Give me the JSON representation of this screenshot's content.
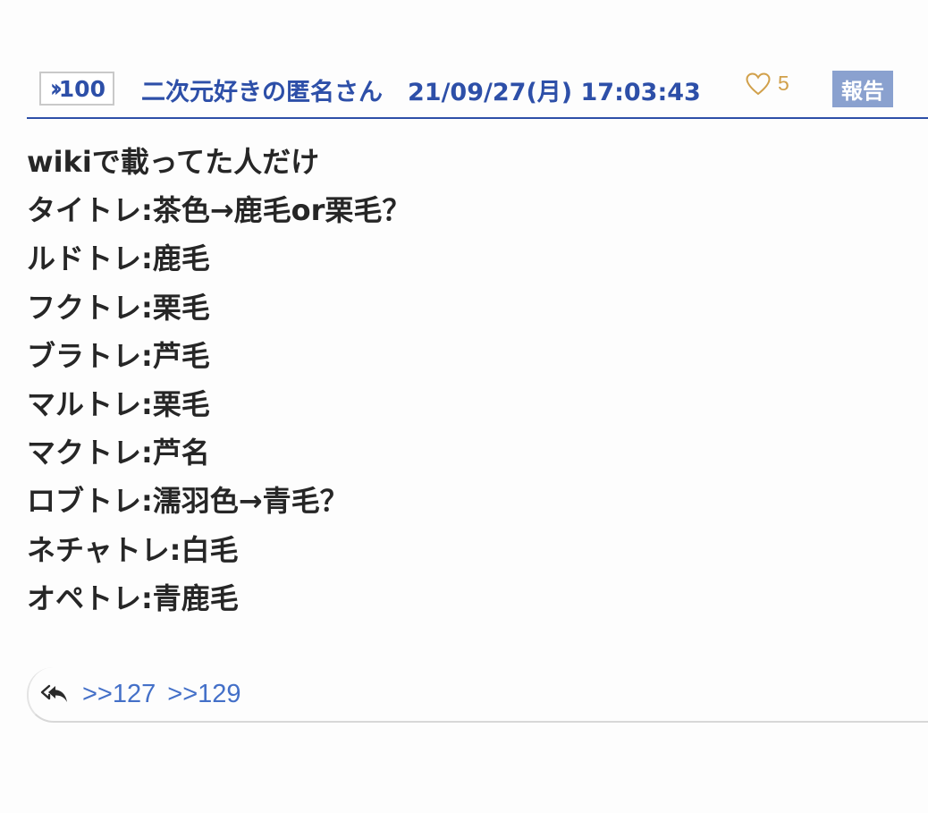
{
  "post": {
    "number": "100",
    "poster_name": "二次元好きの匿名さん",
    "date": "21/09/27(月) 17:03:43",
    "likes": "5",
    "report_label": "報告",
    "body_lines": [
      "wikiで載ってた人だけ",
      "タイトレ:茶色→鹿毛or栗毛？",
      "ルドトレ:鹿毛",
      "フクトレ:栗毛",
      "ブラトレ:芦毛",
      "マルトレ:栗毛",
      "マクトレ:芦名",
      "ロブトレ:濡羽色→青毛？",
      "ネチャトレ:白毛",
      "オペトレ:青鹿毛"
    ],
    "replies": [
      ">>127",
      ">>129"
    ]
  },
  "icons": {
    "res_prefix": "chevron-double-right-icon",
    "like": "heart-outline-icon",
    "reply": "reply-all-icon"
  },
  "colors": {
    "accent": "#2d4fa8",
    "like": "#d1a04a",
    "report_bg": "#8aa1cf",
    "reply_link": "#4470c8"
  }
}
